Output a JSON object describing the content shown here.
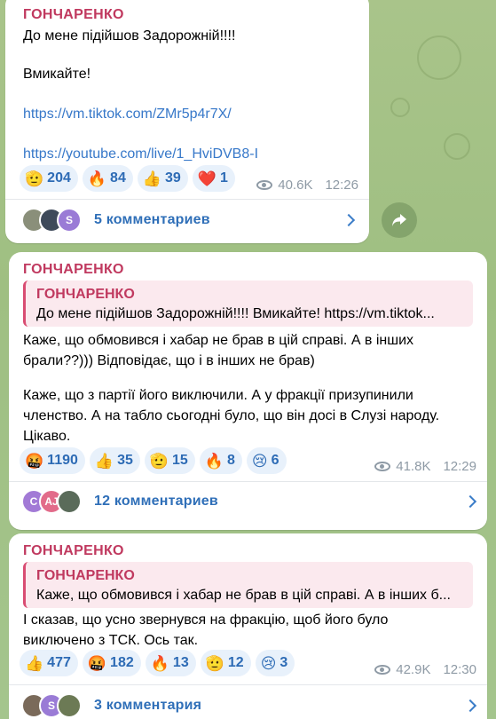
{
  "posts": [
    {
      "author": "ГОНЧАРЕНКО",
      "lines": [
        "До мене підійшов Задорожній!!!!",
        "Вмикайте!"
      ],
      "links": [
        "https://vm.tiktok.com/ZMr5p4r7X/",
        "https://youtube.com/live/1_HviDVB8-I"
      ],
      "reactions": [
        {
          "emoji": "🫡",
          "count": "204"
        },
        {
          "emoji": "🔥",
          "count": "84"
        },
        {
          "emoji": "👍",
          "count": "39"
        },
        {
          "emoji": "❤️",
          "count": "1"
        }
      ],
      "views": "40.6K",
      "time": "12:26",
      "comments_label": "5 комментариев",
      "avatars": [
        {
          "text": "",
          "color": "#8a8f7a"
        },
        {
          "text": "",
          "color": "#3e4a5a"
        },
        {
          "text": "S",
          "color": "#9a7bd6"
        }
      ]
    },
    {
      "author": "ГОНЧАРЕНКО",
      "quote_author": "ГОНЧАРЕНКО",
      "quote_text": "До мене підійшов Задорожній!!!!   Вмикайте!  https://vm.tiktok...",
      "lines": [
        "Каже, що обмовився і хабар не брав в цій справі. А в інших",
        "брали??))) Відповідає, що і в інших не брав)",
        "",
        "Каже, що з партії його виключили. А у фракції призупинили",
        "членство. А на табло сьогодні було, що він досі в Слузі народу.",
        "Цікаво."
      ],
      "reactions": [
        {
          "emoji": "🤬",
          "count": "1190"
        },
        {
          "emoji": "👍",
          "count": "35"
        },
        {
          "emoji": "🫡",
          "count": "15"
        },
        {
          "emoji": "🔥",
          "count": "8"
        },
        {
          "emoji": "😢",
          "count": "6"
        }
      ],
      "views": "41.8K",
      "time": "12:29",
      "comments_label": "12 комментариев",
      "avatars": [
        {
          "text": "C",
          "color": "#a27ad6"
        },
        {
          "text": "AJ",
          "color": "#e26b8a"
        },
        {
          "text": "",
          "color": "#5a6b5a"
        }
      ]
    },
    {
      "author": "ГОНЧАРЕНКО",
      "quote_author": "ГОНЧАРЕНКО",
      "quote_text": "Каже, що обмовився і хабар не брав в цій справі. А в інших б...",
      "lines": [
        "І сказав, що усно звернувся на фракцію, щоб його було",
        "виключено з ТСК. Ось так."
      ],
      "reactions": [
        {
          "emoji": "👍",
          "count": "477"
        },
        {
          "emoji": "🤬",
          "count": "182"
        },
        {
          "emoji": "🔥",
          "count": "13"
        },
        {
          "emoji": "🫡",
          "count": "12"
        },
        {
          "emoji": "😢",
          "count": "3"
        }
      ],
      "views": "42.9K",
      "time": "12:30",
      "comments_label": "3 комментария",
      "avatars": [
        {
          "text": "",
          "color": "#7a6a5a"
        },
        {
          "text": "S",
          "color": "#9a7bd6"
        },
        {
          "text": "",
          "color": "#6c7a55"
        }
      ]
    }
  ]
}
